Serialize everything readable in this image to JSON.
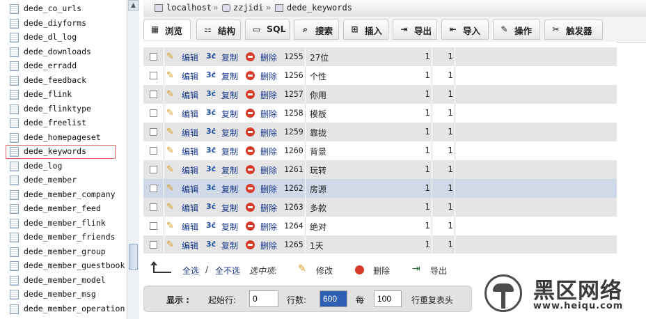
{
  "sidebar": {
    "tables": [
      "dede_co_urls",
      "dede_diyforms",
      "dede_dl_log",
      "dede_downloads",
      "dede_erradd",
      "dede_feedback",
      "dede_flink",
      "dede_flinktype",
      "dede_freelist",
      "dede_homepageset",
      "dede_keywords",
      "dede_log",
      "dede_member",
      "dede_member_company",
      "dede_member_feed",
      "dede_member_flink",
      "dede_member_friends",
      "dede_member_group",
      "dede_member_guestbook",
      "dede_member_model",
      "dede_member_msg",
      "dede_member_operation"
    ],
    "active": "dede_keywords"
  },
  "breadcrumb": {
    "server": "localhost",
    "database": "zzjidi",
    "table": "dede_keywords",
    "separator": "»"
  },
  "tabs": [
    {
      "label": "浏览",
      "icon": "browse-icon"
    },
    {
      "label": "结构",
      "icon": "structure-icon"
    },
    {
      "label": "SQL",
      "icon": "sql-icon"
    },
    {
      "label": "搜索",
      "icon": "search-icon"
    },
    {
      "label": "插入",
      "icon": "insert-icon"
    },
    {
      "label": "导出",
      "icon": "export-icon"
    },
    {
      "label": "导入",
      "icon": "import-icon"
    },
    {
      "label": "操作",
      "icon": "wrench-icon"
    },
    {
      "label": "触发器",
      "icon": "trigger-icon"
    }
  ],
  "row_actions": {
    "edit": "编辑",
    "copy": "复制",
    "delete": "删除"
  },
  "rows": [
    {
      "id": "1255",
      "keyword": "27位",
      "rank": "1",
      "count": "1"
    },
    {
      "id": "1256",
      "keyword": "个性",
      "rank": "1",
      "count": "1"
    },
    {
      "id": "1257",
      "keyword": "你用",
      "rank": "1",
      "count": "1"
    },
    {
      "id": "1258",
      "keyword": "模板",
      "rank": "1",
      "count": "1"
    },
    {
      "id": "1259",
      "keyword": "靠拢",
      "rank": "1",
      "count": "1"
    },
    {
      "id": "1260",
      "keyword": "背景",
      "rank": "1",
      "count": "1"
    },
    {
      "id": "1261",
      "keyword": "玩转",
      "rank": "1",
      "count": "1"
    },
    {
      "id": "1262",
      "keyword": "房源",
      "rank": "1",
      "count": "1"
    },
    {
      "id": "1263",
      "keyword": "多款",
      "rank": "1",
      "count": "1"
    },
    {
      "id": "1264",
      "keyword": "绝对",
      "rank": "1",
      "count": "1"
    },
    {
      "id": "1265",
      "keyword": "1天",
      "rank": "1",
      "count": "1"
    }
  ],
  "highlighted_row_id": "1262",
  "bulk_actions": {
    "select_all": "全选",
    "slash": "/",
    "deselect_all": "全不选",
    "with_selected": "选中项:",
    "edit": "修改",
    "delete": "删除",
    "export": "导出"
  },
  "display": {
    "show_label": "显示 :",
    "start_row_label": "起始行:",
    "start_row_value": "0",
    "rows_label": "行数:",
    "rows_value": "600",
    "every_label": "每",
    "repeat_value": "100",
    "repeat_label": "行重复表头"
  },
  "watermark": {
    "title": "黑区网络",
    "url": "www.heiqu.com"
  },
  "colors": {
    "highlight_row": "#cfd8e6",
    "active_outline": "#e06060",
    "link": "#1a3a8c"
  }
}
